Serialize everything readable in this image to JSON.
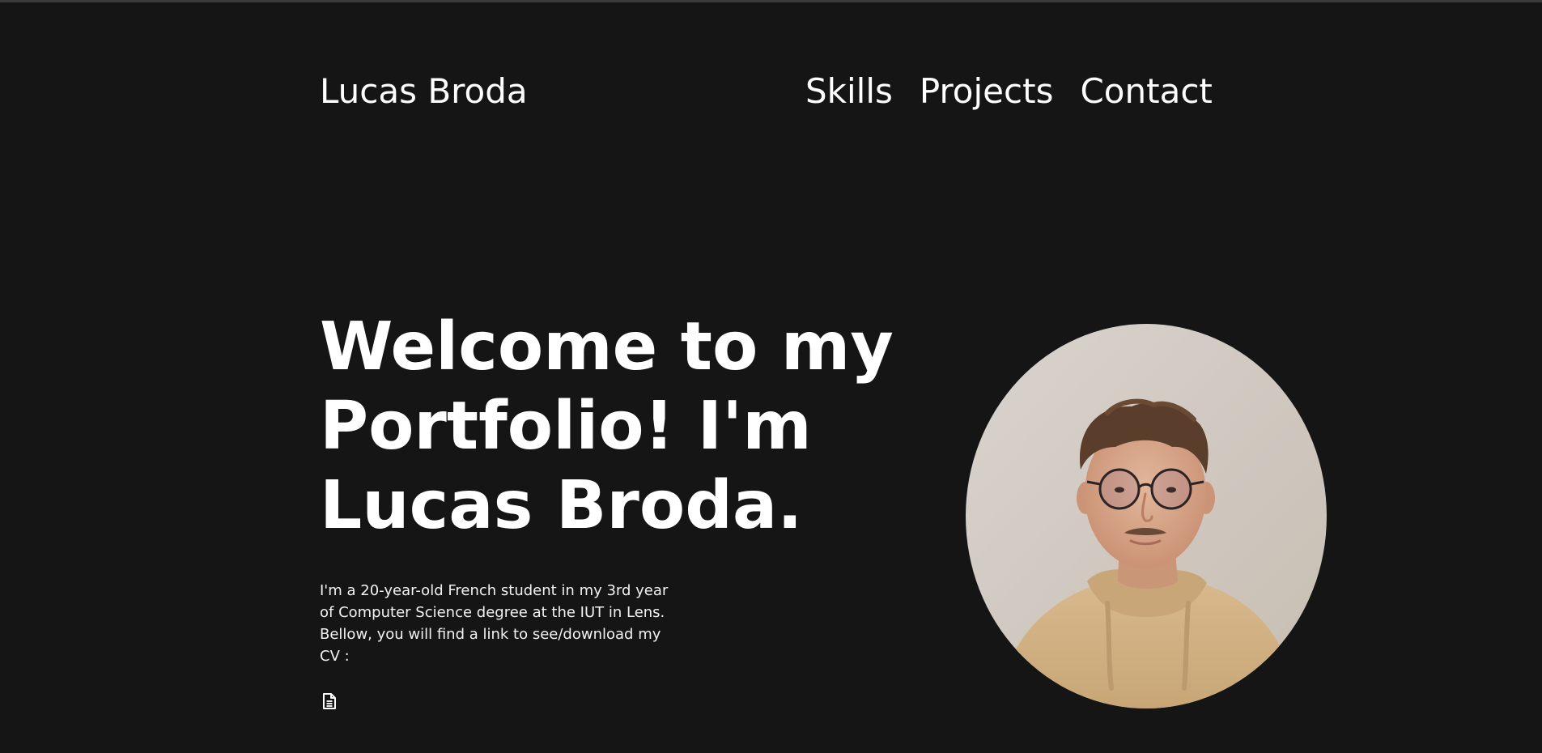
{
  "header": {
    "brand": "Lucas Broda",
    "nav": [
      {
        "label": "Skills"
      },
      {
        "label": "Projects"
      },
      {
        "label": "Contact"
      }
    ]
  },
  "hero": {
    "title": "Welcome to my Portfolio! I'm Lucas Broda.",
    "description": "I'm a 20-year-old French student in my 3rd year of Computer Science degree at the IUT in Lens. Bellow, you will find a link to see/download my CV :",
    "cv_icon": "document-icon",
    "photo_icon": "profile-photo"
  },
  "colors": {
    "background": "#151515",
    "text": "#ffffff"
  }
}
